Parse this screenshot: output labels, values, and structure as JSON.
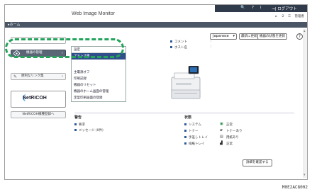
{
  "header": {
    "title": "Web Image Monitor",
    "top_items": [
      "🔍",
      "?",
      "i",
      "→| ログアウト"
    ],
    "sub_items": [
      "⌂",
      "-2",
      "☰",
      "管理者"
    ]
  },
  "breadcrumb": "▸ホーム",
  "toolbar": {
    "language": "Japanese",
    "refresh_label": "最新に更新",
    "update_label": "機器の状態を更新",
    "help": "?"
  },
  "sidebar": {
    "device_label": "機器の管理",
    "links_label": "便利なリンク集",
    "netricoh_label": "NetRICOH",
    "netricoh_reg_label": "NetRICOH機種登録へ"
  },
  "menu": {
    "items": [
      "設定",
      "アドレス帳",
      "主電源オフ",
      "印刷記録",
      "機器のリセット",
      "機器のホーム画面の管理",
      "定型印刷画面の登録"
    ],
    "selected_index": 1
  },
  "device_info": {
    "comment_label": "コメント",
    "comment_value": ":",
    "host_label": "ホスト名",
    "host_value": ":"
  },
  "alerts": {
    "title": "警告",
    "items": [
      "要求",
      "メッセージ (0件)"
    ]
  },
  "status": {
    "title": "状態",
    "rows": [
      {
        "label": "システム",
        "icon": "ok-icon",
        "value": "正常"
      },
      {
        "label": "トナー",
        "icon": "toner-icon",
        "value": "トナーあり"
      },
      {
        "label": "手差しトレイ",
        "icon": "paper-icon",
        "value": "用紙あり"
      },
      {
        "label": "排紙トレイ",
        "icon": "tray-icon",
        "value": "正常"
      }
    ],
    "detail_button": "詳細を確認する"
  },
  "image_code": "M0E2AC8002",
  "colors": {
    "highlight": "#23a35a",
    "menu_selected": "#2e4f8a",
    "header_dark": "#2f3a4a"
  }
}
